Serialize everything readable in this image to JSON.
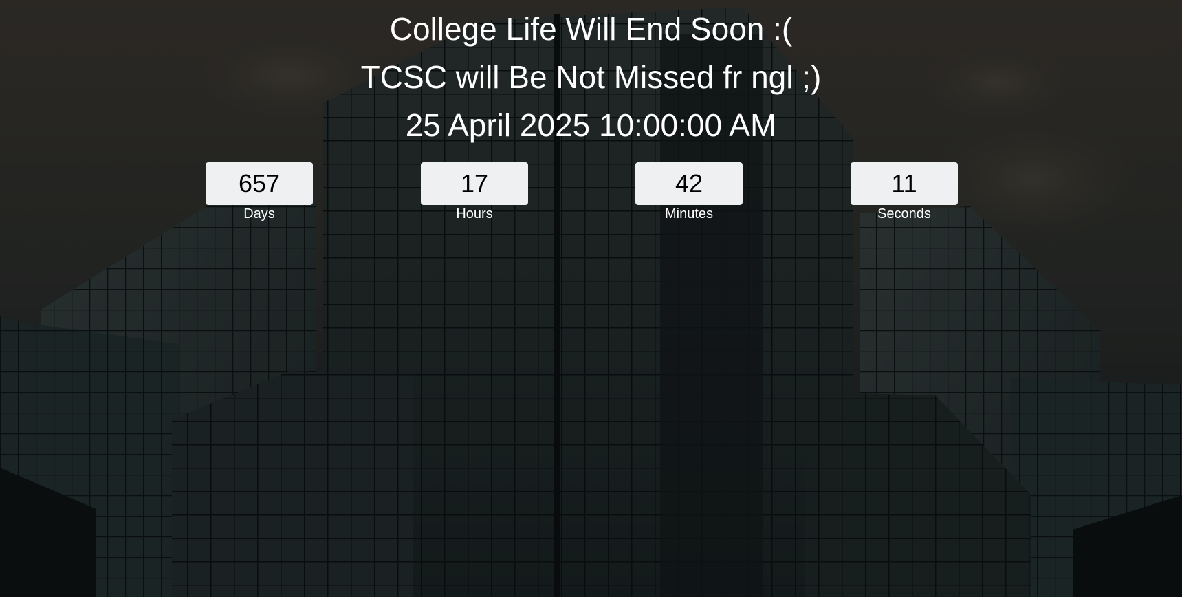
{
  "page": {
    "heading_line1": "College Life Will End Soon :(",
    "heading_line2": "TCSC will Be Not Missed fr ngl ;)",
    "target_datetime": "25 April 2025 10:00:00 AM"
  },
  "countdown": [
    {
      "value": "657",
      "label": "Days"
    },
    {
      "value": "17",
      "label": "Hours"
    },
    {
      "value": "42",
      "label": "Minutes"
    },
    {
      "value": "11",
      "label": "Seconds"
    }
  ],
  "colors": {
    "text": "#ffffff",
    "box_background": "#eef0f2",
    "number_text": "#000000",
    "background_tint": "#1c2222"
  }
}
